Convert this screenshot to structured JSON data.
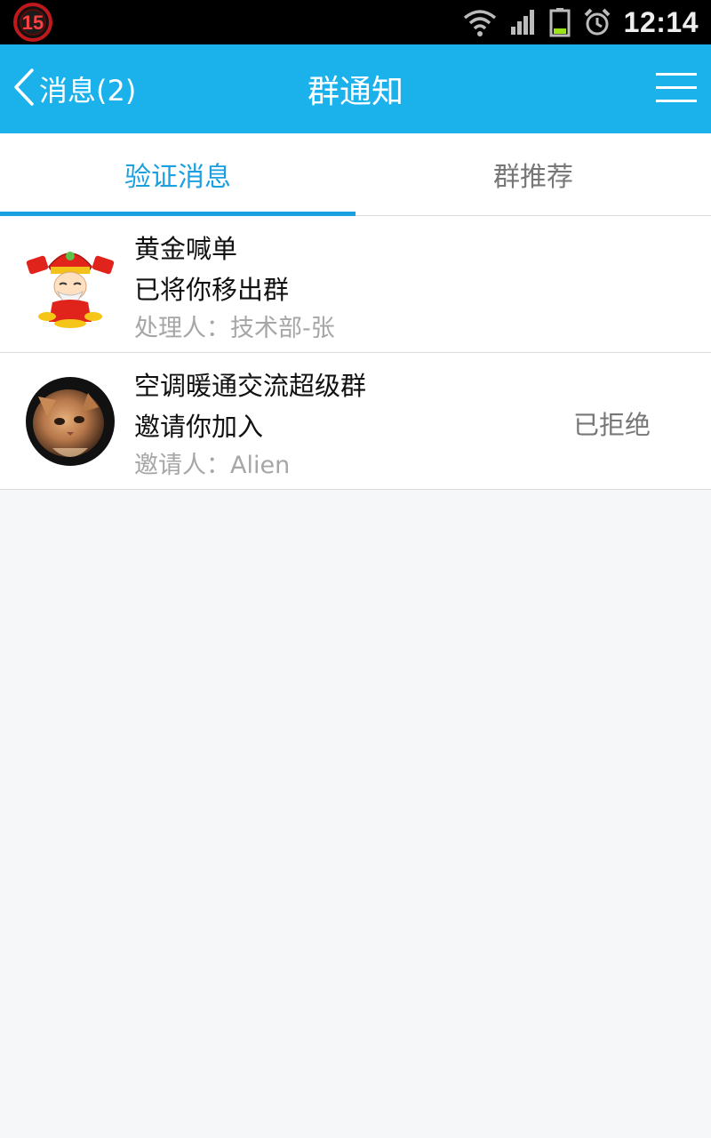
{
  "status_bar": {
    "badge_number": "15",
    "time": "12:14",
    "icons": [
      "wifi-icon",
      "signal-icon",
      "battery-icon",
      "alarm-icon"
    ]
  },
  "title_bar": {
    "back_label": "消息(2)",
    "title": "群通知",
    "menu_icon": "menu-icon"
  },
  "tabs": [
    {
      "label": "验证消息",
      "active": true
    },
    {
      "label": "群推荐",
      "active": false
    }
  ],
  "notifications": [
    {
      "group_name": "黄金喊单",
      "action": "已将你移出群",
      "meta": "处理人：技术部-张",
      "status": "",
      "avatar": "cartoon-god-of-wealth"
    },
    {
      "group_name": "空调暖通交流超级群",
      "action": "邀请你加入",
      "meta": "邀请人：Alien",
      "status": "已拒绝",
      "avatar": "cat-photo"
    }
  ],
  "colors": {
    "accent": "#1bb2ec",
    "tab_active": "#1aa0e0",
    "background": "#f6f7f9"
  }
}
